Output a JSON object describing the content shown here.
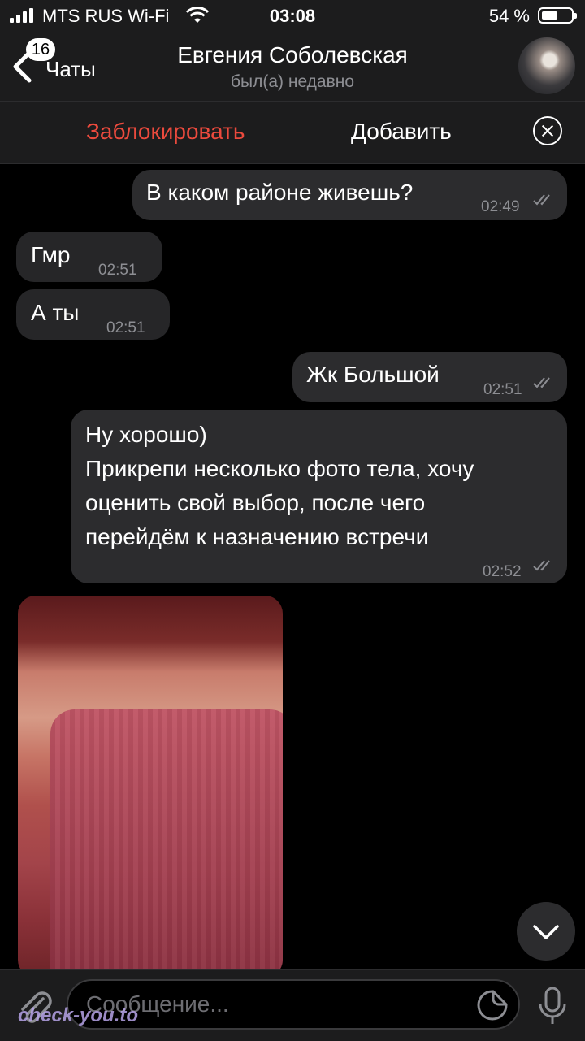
{
  "status_bar": {
    "carrier": "MTS RUS Wi-Fi",
    "time": "03:08",
    "battery_percent": "54 %"
  },
  "header": {
    "back_label": "Чаты",
    "unread_badge": "16",
    "contact_name": "Евгения Соболевская",
    "last_seen": "был(а) недавно"
  },
  "action_bar": {
    "block_label": "Заблокировать",
    "add_label": "Добавить"
  },
  "messages": [
    {
      "direction": "outgoing",
      "text": "В каком районе живешь?",
      "time": "02:49",
      "read": true
    },
    {
      "direction": "incoming",
      "text": "Гмр",
      "time": "02:51"
    },
    {
      "direction": "incoming",
      "text": "А ты",
      "time": "02:51"
    },
    {
      "direction": "outgoing",
      "text": "Жк Большой",
      "time": "02:51",
      "read": true
    },
    {
      "direction": "outgoing",
      "lines": [
        "Ну хорошо)",
        "Прикрепи несколько фото тела, хочу",
        "оценить свой выбор, после чего",
        "перейдём к назначению встречи"
      ],
      "time": "02:52",
      "read": true
    },
    {
      "direction": "incoming",
      "type": "photo"
    }
  ],
  "input": {
    "placeholder": "Сообщение..."
  },
  "watermark": "check-you.to",
  "colors": {
    "block_red": "#eb4a3d",
    "bubble": "#262628",
    "header_bg": "#1c1c1d"
  }
}
